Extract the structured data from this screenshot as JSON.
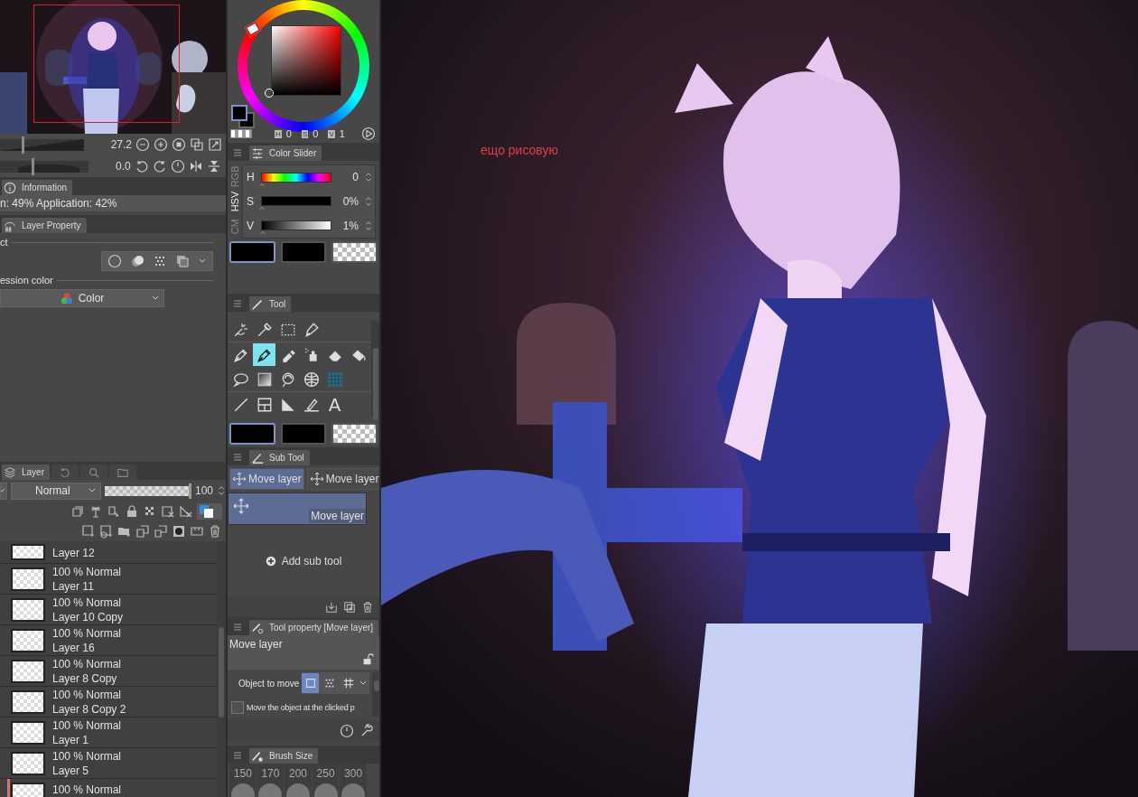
{
  "navigator": {
    "zoom": "27.2",
    "angle": "0.0",
    "zoom_slider": {
      "level": 0.26
    },
    "angle_slider": {
      "level": 0.36
    }
  },
  "information": {
    "tab": "Information",
    "text": "n: 49% Application: 42%"
  },
  "layer_property": {
    "tab": "Layer Property",
    "effect_label": "ct",
    "expression_label": "ession color",
    "expression_value": "Color"
  },
  "color_wheel": {
    "readout": [
      {
        "label": "H",
        "value": "0"
      },
      {
        "label": "S",
        "value": "0"
      },
      {
        "label": "V",
        "value": "1"
      }
    ]
  },
  "color_slider": {
    "tab": "Color Slider",
    "modes": [
      {
        "label": "RGB",
        "selected": false
      },
      {
        "label": "HSV",
        "selected": true
      },
      {
        "label": "CM",
        "selected": false
      }
    ],
    "rows": [
      {
        "label": "H",
        "kind": "hue",
        "level": 0,
        "value": "0"
      },
      {
        "label": "S",
        "kind": "saturation",
        "level": 0,
        "value": "0%"
      },
      {
        "label": "V",
        "kind": "value",
        "level": 0.01,
        "value": "1%"
      }
    ],
    "swatches": [
      {
        "kind": "main",
        "selected": true
      },
      {
        "kind": "sub",
        "selected": false
      },
      {
        "kind": "transparent",
        "selected": false
      }
    ]
  },
  "tool": {
    "tab": "Tool",
    "rows": [
      [
        {
          "kind": "wand",
          "selected": false
        },
        {
          "kind": "eyedropper",
          "selected": false
        },
        {
          "kind": "marquee",
          "selected": false
        },
        {
          "kind": "nib",
          "selected": false
        }
      ],
      [
        {
          "kind": "pen",
          "selected": false
        },
        {
          "kind": "pen",
          "selected": true
        },
        {
          "kind": "marker",
          "selected": false
        },
        {
          "kind": "spray",
          "selected": false
        },
        {
          "kind": "eraser",
          "selected": false
        },
        {
          "kind": "bucket",
          "selected": false
        }
      ],
      [
        {
          "kind": "balloon",
          "selected": false
        },
        {
          "kind": "gradient",
          "selected": false
        },
        {
          "kind": "lasso",
          "selected": false
        },
        {
          "kind": "globe",
          "selected": false
        },
        {
          "kind": "tone",
          "selected": false
        }
      ],
      [
        {
          "kind": "line",
          "selected": false
        },
        {
          "kind": "frame",
          "selected": false
        },
        {
          "kind": "ruler",
          "selected": false
        },
        {
          "kind": "correction",
          "selected": false
        },
        {
          "kind": "text",
          "glyph": "A",
          "selected": false
        }
      ]
    ],
    "swatches": [
      {
        "kind": "main",
        "selected": true
      },
      {
        "kind": "sub",
        "selected": false
      },
      {
        "kind": "transparent",
        "selected": false
      }
    ]
  },
  "sub_tool": {
    "tab": "Sub Tool",
    "groups": [
      {
        "label": "Move layer",
        "selected": true
      },
      {
        "label": "Move layer",
        "selected": false
      }
    ],
    "items": [
      {
        "label": "Move layer",
        "selected": true
      }
    ],
    "add_label": "Add sub tool"
  },
  "tool_property": {
    "tab": "Tool property [Move layer]",
    "name": "Move layer",
    "object_label": "Object to move",
    "options": [
      {
        "kind": "layer",
        "selected": true
      },
      {
        "kind": "tone",
        "selected": false
      },
      {
        "kind": "grid",
        "selected": false
      }
    ],
    "checkbox": {
      "label": "Move the object at the clicked p",
      "checked": false
    }
  },
  "brush_size": {
    "tab": "Brush Size",
    "sizes": [
      "150",
      "170",
      "200",
      "250",
      "300"
    ]
  },
  "layer_panel": {
    "tab": "Layer",
    "blend": "Normal",
    "opacity": "100",
    "opacity_slider": {
      "level": 1
    },
    "layers": [
      {
        "name": "Layer 12",
        "marked": false
      },
      {
        "mode": "100 % Normal",
        "name": "Layer 11",
        "marked": false
      },
      {
        "mode": "100 % Normal",
        "name": "Layer 10 Copy",
        "marked": false
      },
      {
        "mode": "100 % Normal",
        "name": "Layer 16",
        "marked": false
      },
      {
        "mode": "100 % Normal",
        "name": "Layer 8 Copy",
        "marked": false
      },
      {
        "mode": "100 % Normal",
        "name": "Layer 8 Copy 2",
        "marked": false
      },
      {
        "mode": "100 % Normal",
        "name": "Layer 1",
        "marked": false
      },
      {
        "mode": "100 % Normal",
        "name": "Layer 5",
        "marked": false
      },
      {
        "mode": "100 % Normal",
        "marked": true
      }
    ]
  },
  "canvas": {
    "note": "ещо рисовую"
  }
}
